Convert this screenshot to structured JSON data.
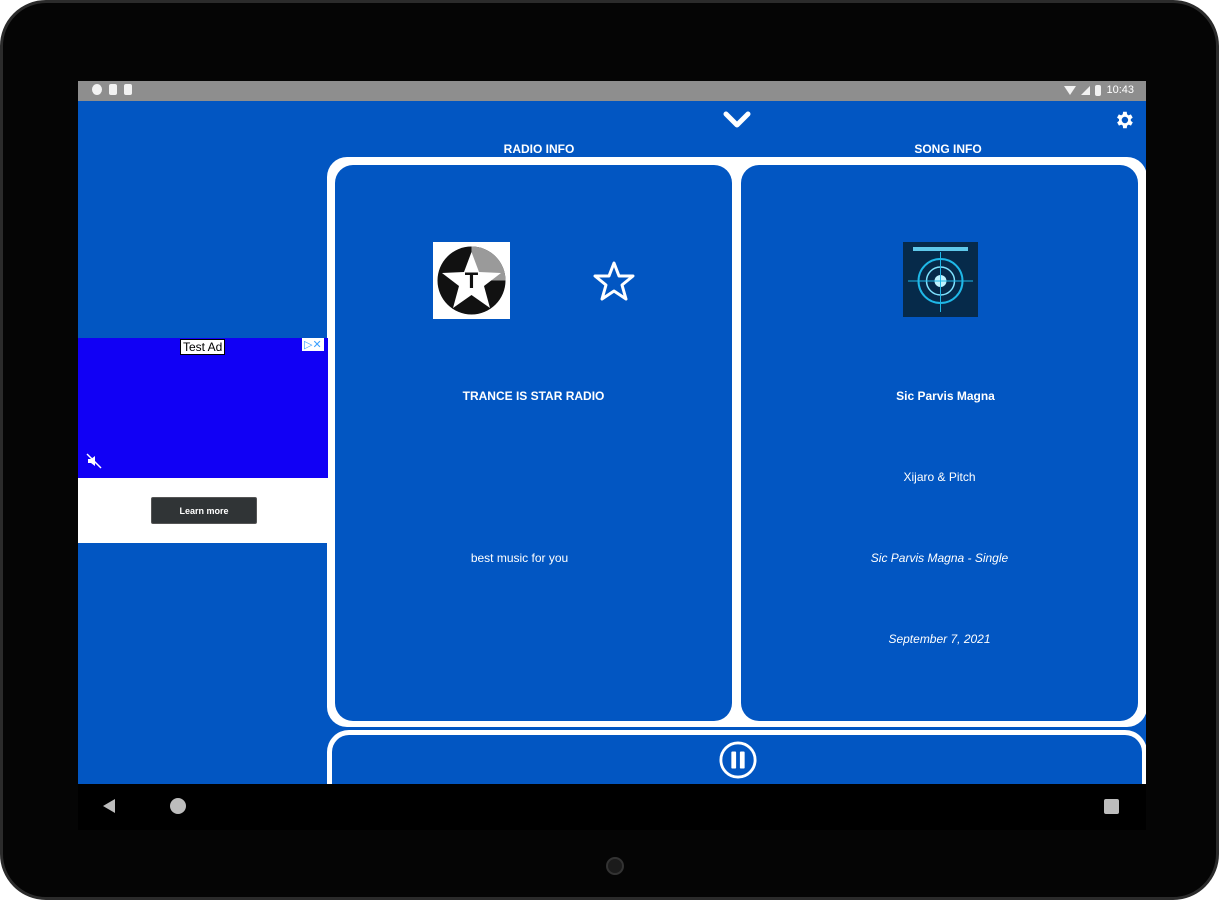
{
  "statusbar": {
    "time": "10:43"
  },
  "header": {
    "radio_info_label": "RADIO INFO",
    "song_info_label": "SONG INFO"
  },
  "radio": {
    "logo_letter": "T",
    "name": "TRANCE IS STAR RADIO",
    "description": "best music for you"
  },
  "song": {
    "title": "Sic Parvis Magna",
    "artist": "Xijaro & Pitch",
    "album": "Sic Parvis Magna - Single",
    "date": "September 7, 2021"
  },
  "ad": {
    "label": "Test Ad",
    "choices": "▷✕",
    "button_label": "Learn more"
  },
  "colors": {
    "primary": "#0256c2",
    "ad_blue": "#1100f5",
    "frame": "#ffffff"
  },
  "icons": {
    "chevron": "chevron-down-icon",
    "settings": "gear-icon",
    "favorite": "star-outline-icon",
    "pause": "pause-icon",
    "mute": "mute-icon"
  }
}
